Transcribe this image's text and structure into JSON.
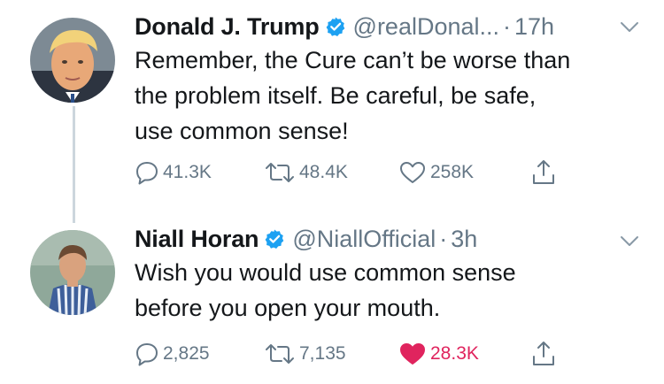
{
  "tweets": [
    {
      "author": {
        "display_name": "Donald J. Trump",
        "handle": "@realDonal...",
        "verified": true,
        "avatar_icon": "person-avatar"
      },
      "time": "17h",
      "separator": "·",
      "lines": [
        "Remember, the Cure can’t be worse than",
        "the problem itself. Be careful, be safe,",
        "use common sense!"
      ],
      "stats": {
        "replies": "41.3K",
        "retweets": "48.4K",
        "likes": "258K",
        "liked": false
      }
    },
    {
      "author": {
        "display_name": "Niall Horan",
        "handle": "@NiallOfficial",
        "verified": true,
        "avatar_icon": "person-avatar"
      },
      "time": "3h",
      "separator": "·",
      "lines": [
        "Wish you would use common sense",
        "before you open your mouth."
      ],
      "stats": {
        "replies": "2,825",
        "retweets": "7,135",
        "likes": "28.3K",
        "liked": true
      }
    }
  ],
  "colors": {
    "text_primary": "#14171a",
    "text_secondary": "#657786",
    "verified_blue": "#1da1f2",
    "like_red": "#e0245e",
    "thread_line": "#ccd6dd"
  }
}
